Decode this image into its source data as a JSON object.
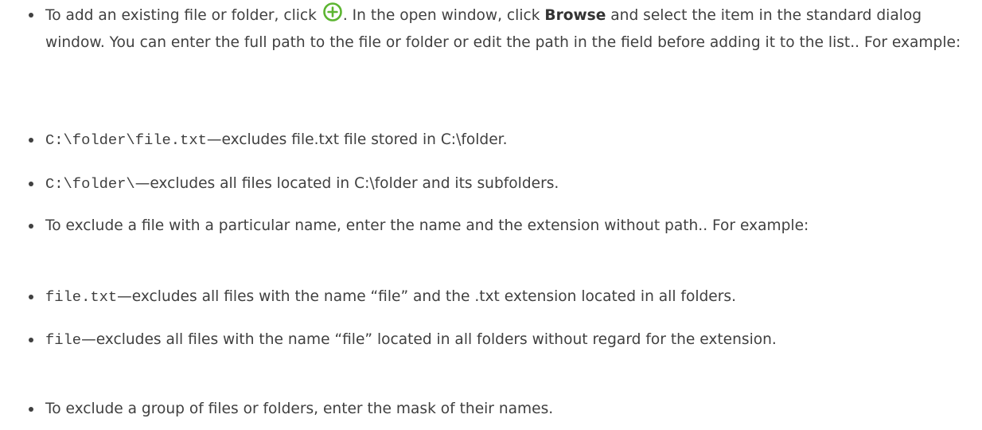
{
  "items": [
    {
      "t1": "To add an existing file or folder, click ",
      "icon": "add-circle-icon",
      "t2": ". In the open window, click ",
      "bold": "Browse",
      "t3": " and select the item in the standard dialog window. You can enter the full path to the file or folder or edit the path in the field before adding it to the list.. For example:"
    },
    {
      "code": "C:\\folder\\file.txt",
      "desc": "—excludes file.txt file stored in C:\\folder."
    },
    {
      "code": "C:\\folder\\",
      "desc": "—excludes all files located in C:\\folder and its subfolders."
    },
    {
      "text": "To exclude a file with a particular name, enter the name and the extension without path.. For example:"
    },
    {
      "code": "file.txt",
      "desc": "—excludes all files with the name “file” and the .txt extension located in all folders."
    },
    {
      "code": "file",
      "desc": "—excludes all files with the name “file” located in all folders without regard for the extension."
    },
    {
      "text": "To exclude a group of files or folders, enter the mask of their names."
    }
  ],
  "colors": {
    "text": "#404040",
    "icon_green": "#5cb531"
  }
}
